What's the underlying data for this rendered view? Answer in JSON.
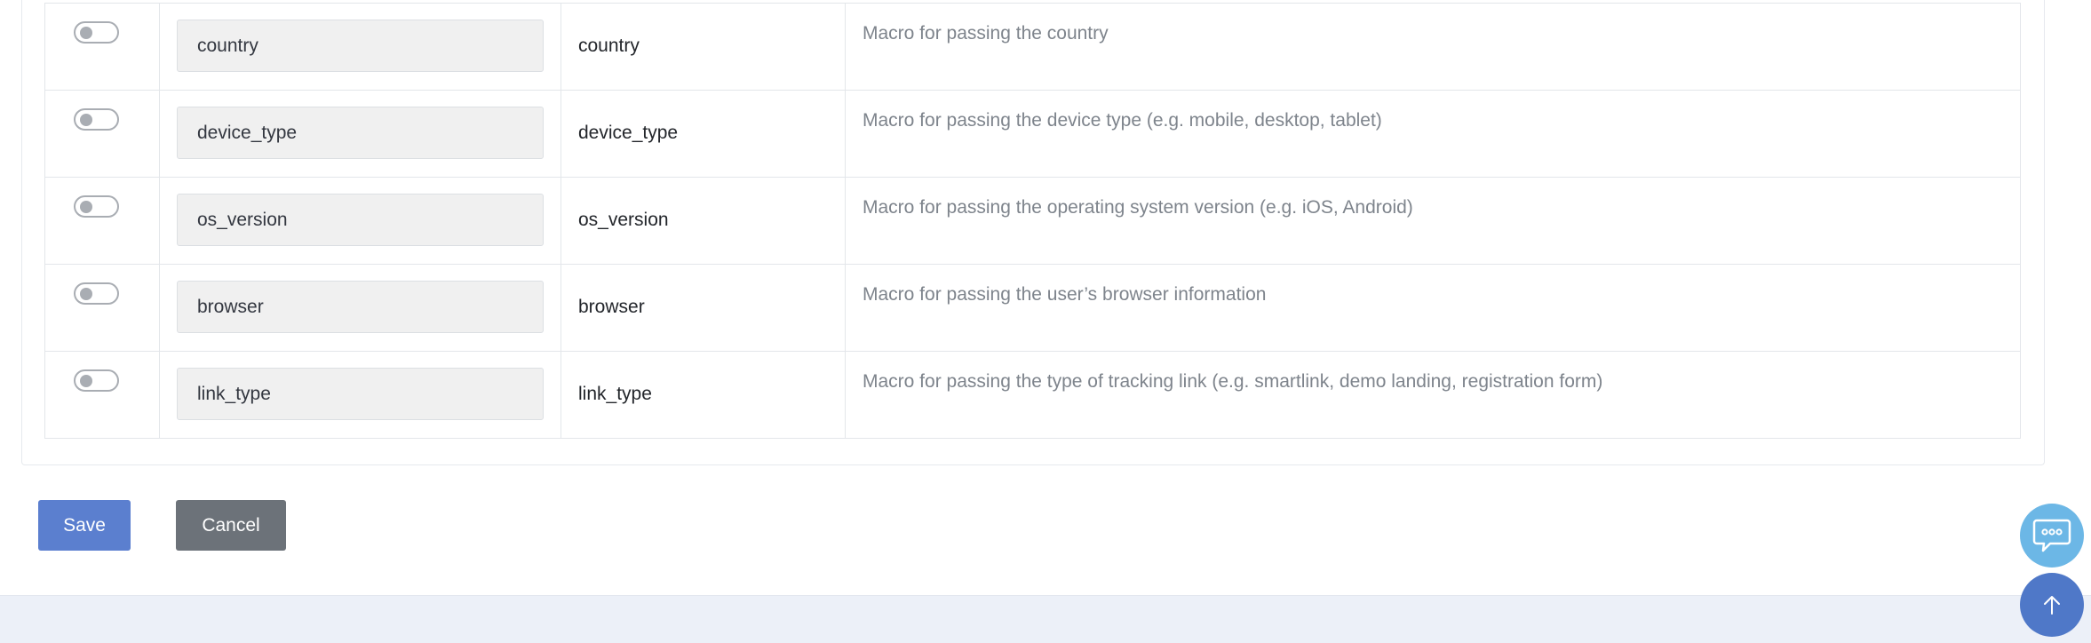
{
  "macros": [
    {
      "enabled": false,
      "value": "country",
      "name": "country",
      "description": "Macro for passing the country"
    },
    {
      "enabled": false,
      "value": "device_type",
      "name": "device_type",
      "description": "Macro for passing the device type (e.g. mobile, desktop, tablet)"
    },
    {
      "enabled": false,
      "value": "os_version",
      "name": "os_version",
      "description": "Macro for passing the operating system version (e.g. iOS, Android)"
    },
    {
      "enabled": false,
      "value": "browser",
      "name": "browser",
      "description": "Macro for passing the user’s browser information"
    },
    {
      "enabled": false,
      "value": "link_type",
      "name": "link_type",
      "description": "Macro for passing the type of tracking link (e.g. smartlink, demo landing, registration form)"
    }
  ],
  "actions": {
    "save_label": "Save",
    "cancel_label": "Cancel"
  },
  "floating": {
    "chat_icon": "chat-icon",
    "scroll_top_icon": "arrow-up-icon"
  },
  "colors": {
    "primary": "#5b7fcf",
    "secondary": "#6c7279",
    "chat_fab": "#6cb7e6",
    "top_fab": "#4f78c8"
  }
}
